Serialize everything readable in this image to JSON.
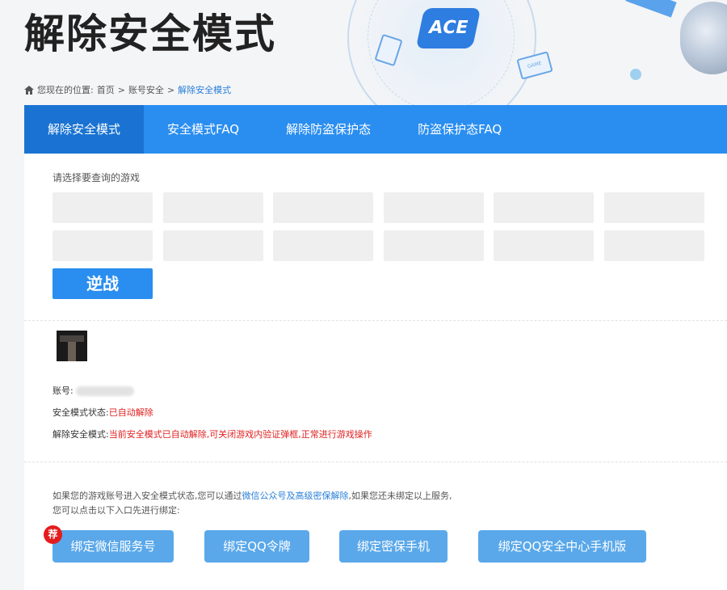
{
  "header": {
    "title": "解除安全模式",
    "logo_text": "ACE",
    "game_card_text": "GAME"
  },
  "breadcrumb": {
    "prefix": "您现在的位置:",
    "items": [
      "首页",
      "账号安全"
    ],
    "separator": ">",
    "current": "解除安全模式"
  },
  "tabs": [
    {
      "label": "解除安全模式",
      "active": true
    },
    {
      "label": "安全模式FAQ",
      "active": false
    },
    {
      "label": "解除防盗保护态",
      "active": false
    },
    {
      "label": "防盗保护态FAQ",
      "active": false
    }
  ],
  "game_select": {
    "prompt": "请选择要查询的游戏",
    "selected_game": "逆战"
  },
  "account": {
    "account_label": "账号:",
    "status_label": "安全模式状态:",
    "status_value": "已自动解除",
    "unlock_label": "解除安全模式:",
    "unlock_value": "当前安全模式已自动解除,可关闭游戏内验证弹框,正常进行游戏操作"
  },
  "binding": {
    "text_before": "如果您的游戏账号进入安全模式状态,您可以通过",
    "text_link": "微信公众号及高级密保解除",
    "text_after": ",如果您还未绑定以上服务,",
    "text_line2": "您可以点击以下入口先进行绑定:",
    "recommend_badge": "荐",
    "buttons": [
      "绑定微信服务号",
      "绑定QQ令牌",
      "绑定密保手机",
      "绑定QQ安全中心手机版"
    ]
  },
  "colors": {
    "tab_bar": "#2a8ef0",
    "tab_active": "#1a73d2",
    "button_blue": "#5aa8ea",
    "status_red": "#e02020",
    "badge_red": "#e51c1c"
  }
}
